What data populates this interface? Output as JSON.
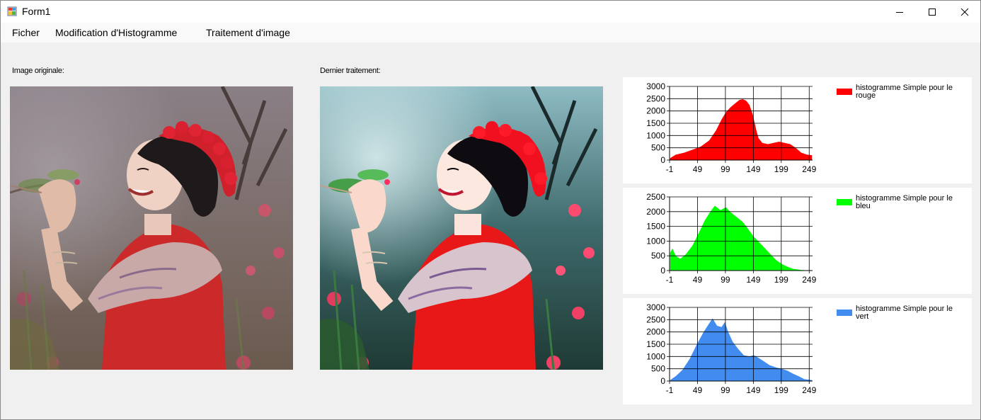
{
  "window": {
    "title": "Form1",
    "minimize_glyph": "—",
    "maximize_glyph": "☐",
    "close_glyph": "✕"
  },
  "menu": {
    "items": [
      {
        "label": "Ficher"
      },
      {
        "label": "Modification d'Histogramme"
      },
      {
        "label": "Traitement d'image"
      }
    ]
  },
  "labels": {
    "original": "Image originale:",
    "processed": "Dernier traitement:"
  },
  "chart_data": [
    {
      "type": "area",
      "series": [
        {
          "name": "histogramme Simple pour le rouge",
          "color": "#ff0000"
        }
      ],
      "xlim": [
        -1,
        255
      ],
      "ylim": [
        0,
        3000
      ],
      "xticks": [
        -1,
        49,
        99,
        149,
        199,
        249
      ],
      "yticks": [
        0,
        500,
        1000,
        1500,
        2000,
        2500,
        3000
      ],
      "grid": true,
      "legend": "right",
      "points": [
        [
          0,
          80
        ],
        [
          10,
          220
        ],
        [
          25,
          300
        ],
        [
          40,
          420
        ],
        [
          55,
          550
        ],
        [
          70,
          800
        ],
        [
          82,
          1200
        ],
        [
          92,
          1650
        ],
        [
          100,
          1950
        ],
        [
          108,
          2150
        ],
        [
          116,
          2300
        ],
        [
          124,
          2450
        ],
        [
          130,
          2480
        ],
        [
          136,
          2420
        ],
        [
          142,
          2250
        ],
        [
          148,
          1850
        ],
        [
          154,
          1250
        ],
        [
          158,
          900
        ],
        [
          165,
          700
        ],
        [
          175,
          650
        ],
        [
          185,
          700
        ],
        [
          195,
          750
        ],
        [
          205,
          700
        ],
        [
          215,
          650
        ],
        [
          225,
          500
        ],
        [
          235,
          300
        ],
        [
          245,
          220
        ],
        [
          254,
          200
        ]
      ]
    },
    {
      "type": "area",
      "series": [
        {
          "name": "histogramme Simple pour le bleu",
          "color": "#00ff00"
        }
      ],
      "xlim": [
        -1,
        255
      ],
      "ylim": [
        0,
        2500
      ],
      "xticks": [
        -1,
        49,
        99,
        149,
        199,
        249
      ],
      "yticks": [
        0,
        500,
        1000,
        1500,
        2000,
        2500
      ],
      "grid": true,
      "legend": "right",
      "points": [
        [
          0,
          600
        ],
        [
          4,
          750
        ],
        [
          10,
          500
        ],
        [
          18,
          400
        ],
        [
          28,
          550
        ],
        [
          40,
          850
        ],
        [
          52,
          1300
        ],
        [
          62,
          1700
        ],
        [
          72,
          2000
        ],
        [
          80,
          2200
        ],
        [
          90,
          2050
        ],
        [
          100,
          2150
        ],
        [
          110,
          1950
        ],
        [
          120,
          1800
        ],
        [
          130,
          1650
        ],
        [
          140,
          1400
        ],
        [
          150,
          1150
        ],
        [
          160,
          950
        ],
        [
          170,
          750
        ],
        [
          180,
          550
        ],
        [
          190,
          350
        ],
        [
          200,
          220
        ],
        [
          210,
          130
        ],
        [
          220,
          60
        ],
        [
          235,
          20
        ],
        [
          254,
          0
        ]
      ]
    },
    {
      "type": "area",
      "series": [
        {
          "name": "histogramme Simple pour le vert",
          "color": "#428cf0"
        }
      ],
      "xlim": [
        -1,
        255
      ],
      "ylim": [
        0,
        3000
      ],
      "xticks": [
        -1,
        49,
        99,
        149,
        199,
        249
      ],
      "yticks": [
        0,
        500,
        1000,
        1500,
        2000,
        2500,
        3000
      ],
      "grid": true,
      "legend": "right",
      "points": [
        [
          0,
          40
        ],
        [
          10,
          200
        ],
        [
          22,
          450
        ],
        [
          35,
          900
        ],
        [
          48,
          1500
        ],
        [
          60,
          2000
        ],
        [
          70,
          2350
        ],
        [
          76,
          2550
        ],
        [
          84,
          2250
        ],
        [
          92,
          2200
        ],
        [
          98,
          2400
        ],
        [
          104,
          2000
        ],
        [
          112,
          1600
        ],
        [
          122,
          1300
        ],
        [
          132,
          1050
        ],
        [
          142,
          1000
        ],
        [
          150,
          1050
        ],
        [
          158,
          950
        ],
        [
          168,
          800
        ],
        [
          178,
          650
        ],
        [
          190,
          550
        ],
        [
          200,
          500
        ],
        [
          210,
          420
        ],
        [
          220,
          300
        ],
        [
          230,
          200
        ],
        [
          240,
          80
        ],
        [
          254,
          40
        ]
      ]
    }
  ]
}
